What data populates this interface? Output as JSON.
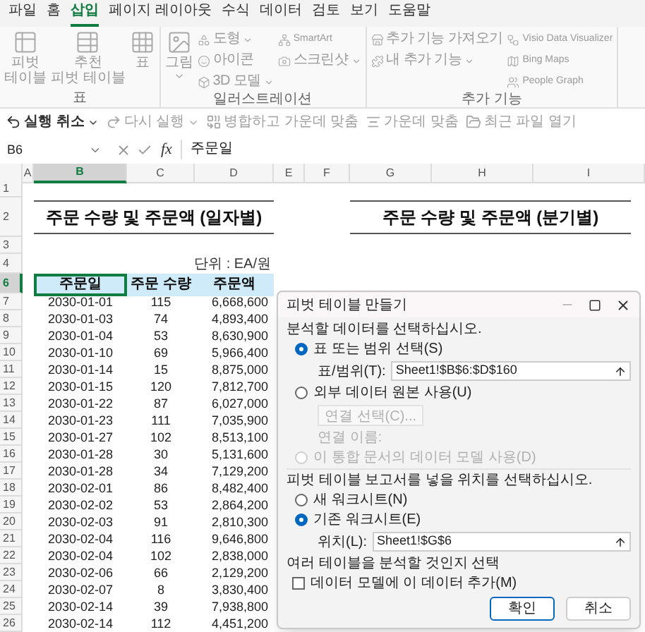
{
  "menu_tabs": [
    {
      "label": "파일",
      "selected": false
    },
    {
      "label": "홈",
      "selected": false
    },
    {
      "label": "삽입",
      "selected": true
    },
    {
      "label": "페이지 레이아웃",
      "selected": false
    },
    {
      "label": "수식",
      "selected": false
    },
    {
      "label": "데이터",
      "selected": false
    },
    {
      "label": "검토",
      "selected": false
    },
    {
      "label": "보기",
      "selected": false
    },
    {
      "label": "도움말",
      "selected": false
    }
  ],
  "ribbon": {
    "disabled": true,
    "groups": [
      {
        "label": "표",
        "items": [
          {
            "kind": "large",
            "lines": [
              "피벗",
              "테이블"
            ],
            "dropdown": false
          },
          {
            "kind": "large",
            "lines": [
              "추천",
              "피벗 테이블"
            ],
            "dropdown": false
          },
          {
            "kind": "large",
            "lines": [
              "표"
            ],
            "dropdown": false
          }
        ]
      },
      {
        "label": "일러스트레이션",
        "items": [
          {
            "kind": "large",
            "lines": [
              "그림"
            ],
            "dropdown": true
          },
          {
            "kind": "stack",
            "entries": [
              {
                "label": "도형",
                "dropdown": true
              },
              {
                "label": "아이콘",
                "dropdown": false
              },
              {
                "label": "3D 모델",
                "dropdown": true
              }
            ]
          },
          {
            "kind": "stack",
            "entries": [
              {
                "label": "SmartArt",
                "dropdown": false
              },
              {
                "label": "스크린샷",
                "dropdown": true
              }
            ]
          }
        ]
      },
      {
        "label": "추가 기능",
        "items": [
          {
            "kind": "stack",
            "entries": [
              {
                "label": "추가 기능 가져오기",
                "dropdown": false
              },
              {
                "label": "내 추가 기능",
                "dropdown": true
              }
            ]
          },
          {
            "kind": "stack",
            "entries": [
              {
                "label": "Visio Data Visualizer",
                "dropdown": false
              },
              {
                "label": "Bing Maps",
                "dropdown": false
              },
              {
                "label": "People Graph",
                "dropdown": false
              }
            ]
          }
        ]
      }
    ]
  },
  "quick_access": [
    {
      "label": "실행 취소",
      "dropdown": true,
      "disabled": false
    },
    {
      "label": "다시 실행",
      "dropdown": true,
      "disabled": true
    },
    {
      "label": "병합하고 가운데 맞춤",
      "dropdown": false,
      "disabled": true
    },
    {
      "label": "가운데 맞춤",
      "dropdown": false,
      "disabled": true
    },
    {
      "label": "최근 파일 열기",
      "dropdown": false,
      "disabled": true
    }
  ],
  "formula_bar": {
    "name_box": "B6",
    "fx": "fx",
    "content": "주문일"
  },
  "sheet": {
    "columns": [
      {
        "label": "A",
        "selected": false
      },
      {
        "label": "B",
        "selected": true
      },
      {
        "label": "C",
        "selected": false
      },
      {
        "label": "D",
        "selected": false
      },
      {
        "label": "E",
        "selected": false
      },
      {
        "label": "F",
        "selected": false
      },
      {
        "label": "G",
        "selected": false
      },
      {
        "label": "H",
        "selected": false
      },
      {
        "label": "I",
        "selected": false
      }
    ],
    "row_headers": [
      {
        "number": "1",
        "selected": false
      },
      {
        "number": "2",
        "selected": false
      },
      {
        "number": "3",
        "selected": false
      },
      {
        "number": "4",
        "selected": false
      },
      {
        "number": "6",
        "selected": true
      }
    ],
    "title_left": "주문 수량 및 주문액 (일자별)",
    "title_right": "주문 수량 및 주문액 (분기별)",
    "unit": "단위 : EA/원",
    "headers": [
      "주문일",
      "주문 수량",
      "주문액"
    ],
    "data_rows": [
      {
        "number": "7",
        "cells": [
          "2030-01-01",
          "115",
          "6,668,600"
        ]
      },
      {
        "number": "8",
        "cells": [
          "2030-01-03",
          "74",
          "4,893,400"
        ]
      },
      {
        "number": "9",
        "cells": [
          "2030-01-04",
          "53",
          "8,630,900"
        ]
      },
      {
        "number": "10",
        "cells": [
          "2030-01-10",
          "69",
          "5,966,400"
        ]
      },
      {
        "number": "11",
        "cells": [
          "2030-01-14",
          "15",
          "8,875,000"
        ]
      },
      {
        "number": "12",
        "cells": [
          "2030-01-15",
          "120",
          "7,812,700"
        ]
      },
      {
        "number": "13",
        "cells": [
          "2030-01-22",
          "87",
          "6,027,000"
        ]
      },
      {
        "number": "14",
        "cells": [
          "2030-01-23",
          "111",
          "7,035,900"
        ]
      },
      {
        "number": "15",
        "cells": [
          "2030-01-27",
          "102",
          "8,513,100"
        ]
      },
      {
        "number": "16",
        "cells": [
          "2030-01-28",
          "30",
          "5,131,600"
        ]
      },
      {
        "number": "17",
        "cells": [
          "2030-01-28",
          "34",
          "7,129,200"
        ]
      },
      {
        "number": "18",
        "cells": [
          "2030-02-01",
          "86",
          "8,482,400"
        ]
      },
      {
        "number": "19",
        "cells": [
          "2030-02-02",
          "53",
          "2,864,200"
        ]
      },
      {
        "number": "20",
        "cells": [
          "2030-02-03",
          "91",
          "2,810,300"
        ]
      },
      {
        "number": "21",
        "cells": [
          "2030-02-04",
          "116",
          "9,646,800"
        ]
      },
      {
        "number": "22",
        "cells": [
          "2030-02-04",
          "102",
          "2,838,000"
        ]
      },
      {
        "number": "23",
        "cells": [
          "2030-02-06",
          "66",
          "2,129,200"
        ]
      },
      {
        "number": "24",
        "cells": [
          "2030-02-07",
          "8",
          "3,830,400"
        ]
      },
      {
        "number": "25",
        "cells": [
          "2030-02-14",
          "39",
          "7,938,800"
        ]
      },
      {
        "number": "26",
        "cells": [
          "2030-02-14",
          "112",
          "4,451,200"
        ]
      }
    ]
  },
  "dialog": {
    "title": "피벗 테이블 만들기",
    "source_heading": "분석할 데이터를 선택하십시오.",
    "source_options": [
      {
        "kind": "range",
        "label": "표 또는 범위 선택(S)",
        "selected": true,
        "disabled": false,
        "field_label": "표/범위(T):",
        "field_value": "Sheet1!$B$6:$D$160"
      },
      {
        "kind": "external",
        "label": "외부 데이터 원본 사용(U)",
        "selected": false,
        "disabled": false,
        "button": "연결 선택(C)...",
        "button_disabled": true,
        "name_label": "연결 이름:"
      },
      {
        "kind": "model",
        "label": "이 통합 문서의 데이터 모델 사용(D)",
        "selected": false,
        "disabled": true
      }
    ],
    "location_heading": "피벗 테이블 보고서를 넣을 위치를 선택하십시오.",
    "location_options": [
      {
        "label": "새 워크시트(N)",
        "selected": false
      },
      {
        "label": "기존 워크시트(E)",
        "selected": true
      }
    ],
    "location_field_label": "위치(L):",
    "location_field_value": "Sheet1!$G$6",
    "multi_heading": "여러 테이블을 분석할 것인지 선택",
    "checkbox": {
      "label": "데이터 모델에 이 데이터 추가(M)",
      "checked": false
    },
    "buttons": [
      {
        "label": "확인",
        "default": true
      },
      {
        "label": "취소",
        "default": false
      }
    ]
  }
}
